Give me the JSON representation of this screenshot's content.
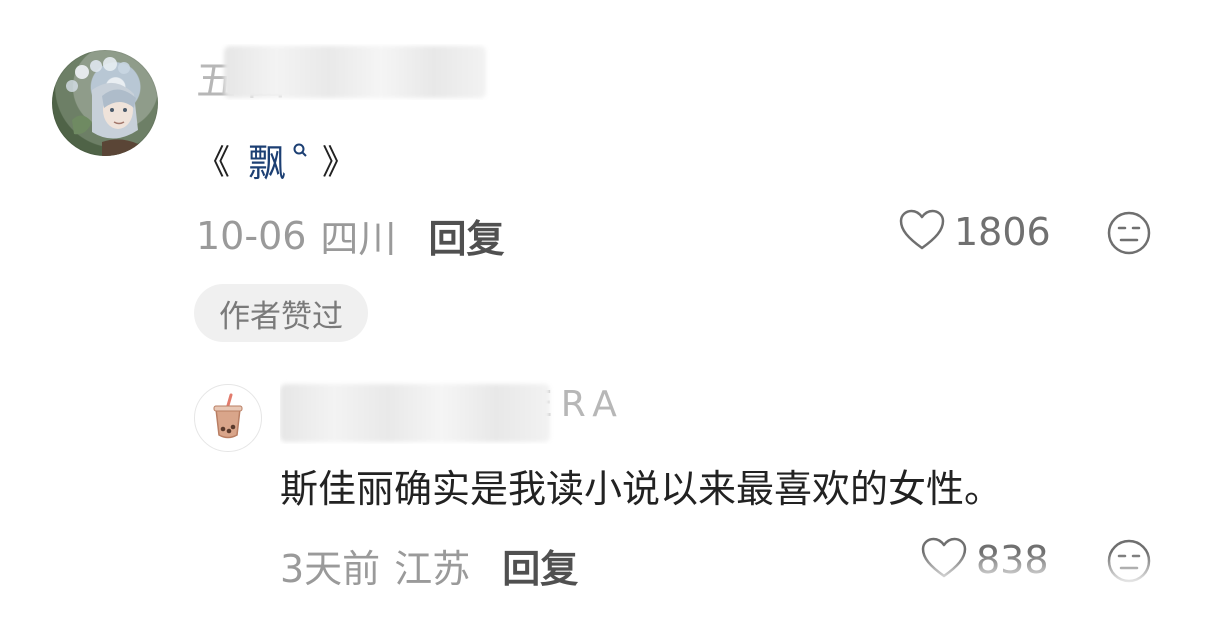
{
  "main_comment": {
    "username_visible": "五囗",
    "text_open": "《",
    "topic": "飘",
    "text_close": "》",
    "date": "10-06",
    "location": "四川",
    "reply_label": "回复",
    "like_count": "1806",
    "author_badge": "作者赞过"
  },
  "reply_comment": {
    "username_visible": "ERA",
    "text": "斯佳丽确实是我读小说以来最喜欢的女性。",
    "date": "3天前",
    "location": "江苏",
    "reply_label": "回复",
    "like_count": "838"
  },
  "icons": {
    "like": "heart-outline-icon",
    "dislike": "meh-face-icon",
    "topic_search": "search-icon",
    "reply_avatar": "bubble-tea-icon"
  },
  "colors": {
    "meta_gray": "#9a9a9a",
    "topic_blue": "#1c3f73",
    "badge_bg": "#f0f0f0",
    "text": "#222222"
  }
}
